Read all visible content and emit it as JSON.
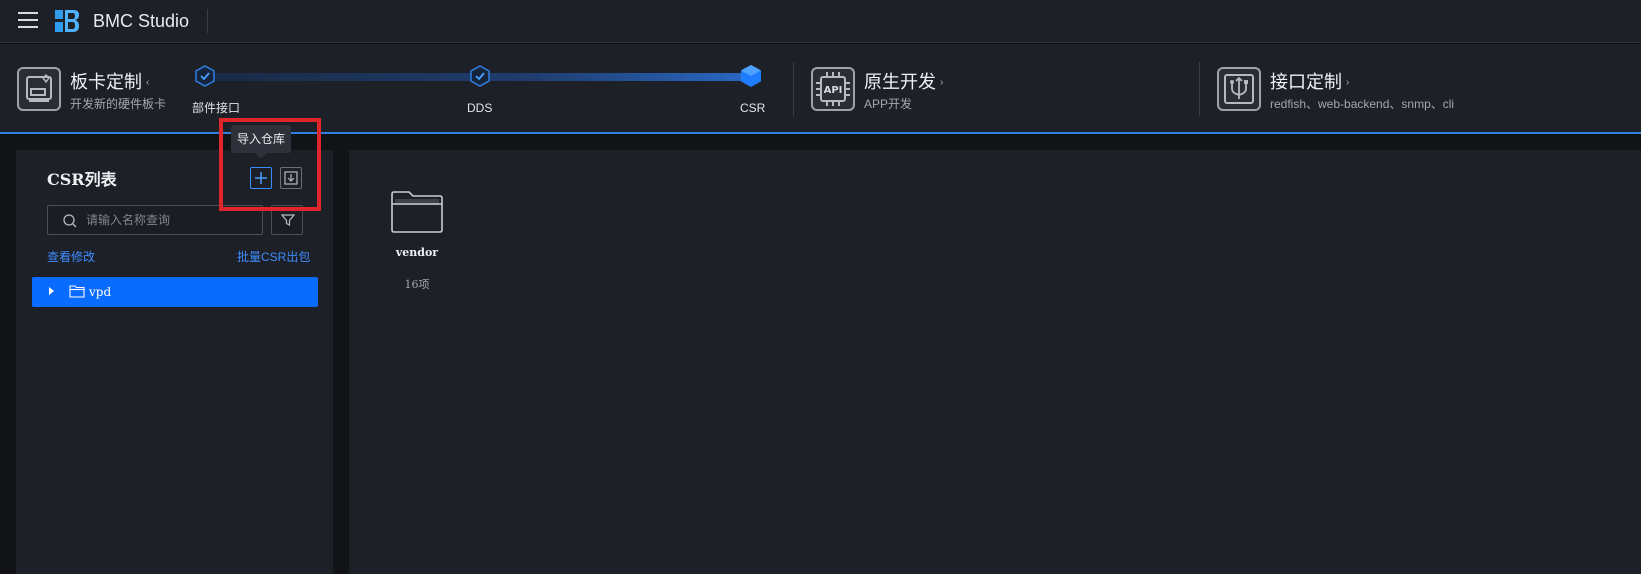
{
  "app": {
    "title": "BMC Studio",
    "accent_color": "#0a6cff"
  },
  "stages": [
    {
      "title": "板卡定制",
      "subtitle": "开发新的硬件板卡",
      "icon": "board-card-icon"
    },
    {
      "title": "原生开发",
      "subtitle": "APP开发",
      "icon": "api-chip-icon"
    },
    {
      "title": "接口定制",
      "subtitle": "redfish、web-backend、snmp、cli",
      "icon": "interface-usb-icon"
    }
  ],
  "steps": [
    {
      "label": "部件接口",
      "state": "done"
    },
    {
      "label": "DDS",
      "state": "done"
    },
    {
      "label": "CSR",
      "state": "current"
    }
  ],
  "progress": 1.0,
  "left_panel": {
    "title": "CSR列表",
    "tooltip": "导入仓库",
    "search_placeholder": "请输入名称查询",
    "link_view_changes": "查看修改",
    "link_batch_export": "批量CSR出包",
    "tree": [
      {
        "label": "vpd",
        "icon": "folder-icon",
        "selected": true
      }
    ]
  },
  "content": {
    "folders": [
      {
        "name": "vendor",
        "count": "16项",
        "icon": "folder-icon"
      }
    ]
  }
}
